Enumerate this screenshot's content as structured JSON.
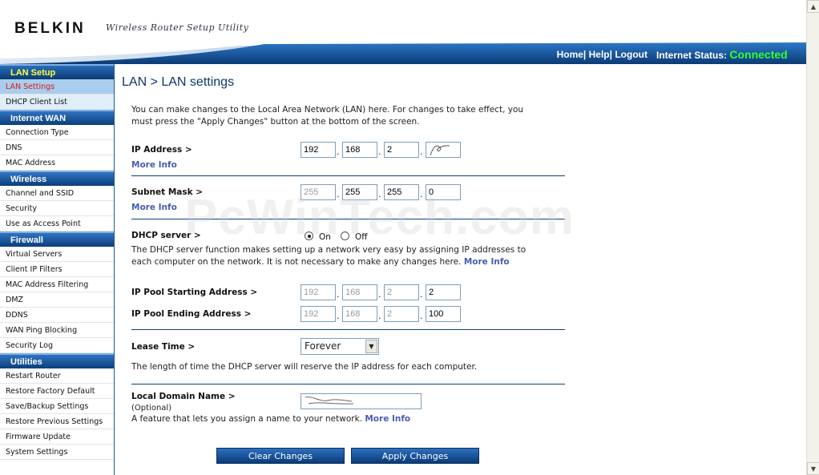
{
  "header": {
    "logo": "BELKIN",
    "tagline": "Wireless Router Setup Utility",
    "links": [
      "Home",
      "Help",
      "Logout"
    ],
    "status_label": "Internet Status:",
    "status_value": "Connected",
    "status_color": "#33ff33",
    "accent_color": "#0c3e7a"
  },
  "sidebar": {
    "sections": [
      {
        "title": "LAN Setup",
        "active": true,
        "items": [
          "LAN Settings",
          "DHCP Client List"
        ]
      },
      {
        "title": "Internet WAN",
        "items": [
          "Connection Type",
          "DNS",
          "MAC Address"
        ]
      },
      {
        "title": "Wireless",
        "items": [
          "Channel and SSID",
          "Security",
          "Use as Access Point"
        ]
      },
      {
        "title": "Firewall",
        "items": [
          "Virtual Servers",
          "Client IP Filters",
          "MAC Address Filtering",
          "DMZ",
          "DDNS",
          "WAN Ping Blocking",
          "Security Log"
        ]
      },
      {
        "title": "Utilities",
        "items": [
          "Restart Router",
          "Restore Factory Default",
          "Save/Backup Settings",
          "Restore Previous Settings",
          "Firmware Update",
          "System Settings"
        ]
      }
    ],
    "current_item": "LAN Settings"
  },
  "main": {
    "title": "LAN > LAN settings",
    "intro_line1": "You can make changes to the Local Area Network (LAN) here. For changes to take effect, you",
    "intro_line2": "must press the \"Apply Changes\" button at the bottom of the screen.",
    "ip_address": {
      "label": "IP Address >",
      "octets": [
        "192",
        "168",
        "2",
        ""
      ],
      "more": "More Info"
    },
    "subnet_mask": {
      "label": "Subnet Mask >",
      "octets": [
        "255",
        "255",
        "255",
        "0"
      ],
      "more": "More Info"
    },
    "dhcp": {
      "label": "DHCP server >",
      "on_label": "On",
      "off_label": "Off",
      "selected": "On",
      "desc_line1": "The DHCP server function makes setting up a network very easy by assigning IP addresses to",
      "desc_line2": "each computer on the network. It is not necessary to make any changes here.",
      "more": "More Info"
    },
    "pool_start": {
      "label": "IP Pool Starting Address >",
      "octets": [
        "192",
        "168",
        "2",
        "2"
      ]
    },
    "pool_end": {
      "label": "IP Pool Ending Address >",
      "octets": [
        "192",
        "168",
        "2",
        "100"
      ]
    },
    "lease": {
      "label": "Lease Time >",
      "value": "Forever",
      "desc": "The length of time the DHCP server will reserve the IP address for each computer."
    },
    "domain": {
      "label": "Local Domain Name >",
      "optional": "(Optional)",
      "desc": "A feature that lets you assign a name to your network.",
      "more": "More Info"
    },
    "buttons": {
      "clear": "Clear Changes",
      "apply": "Apply Changes"
    }
  },
  "watermark": "PcWinTech.com"
}
